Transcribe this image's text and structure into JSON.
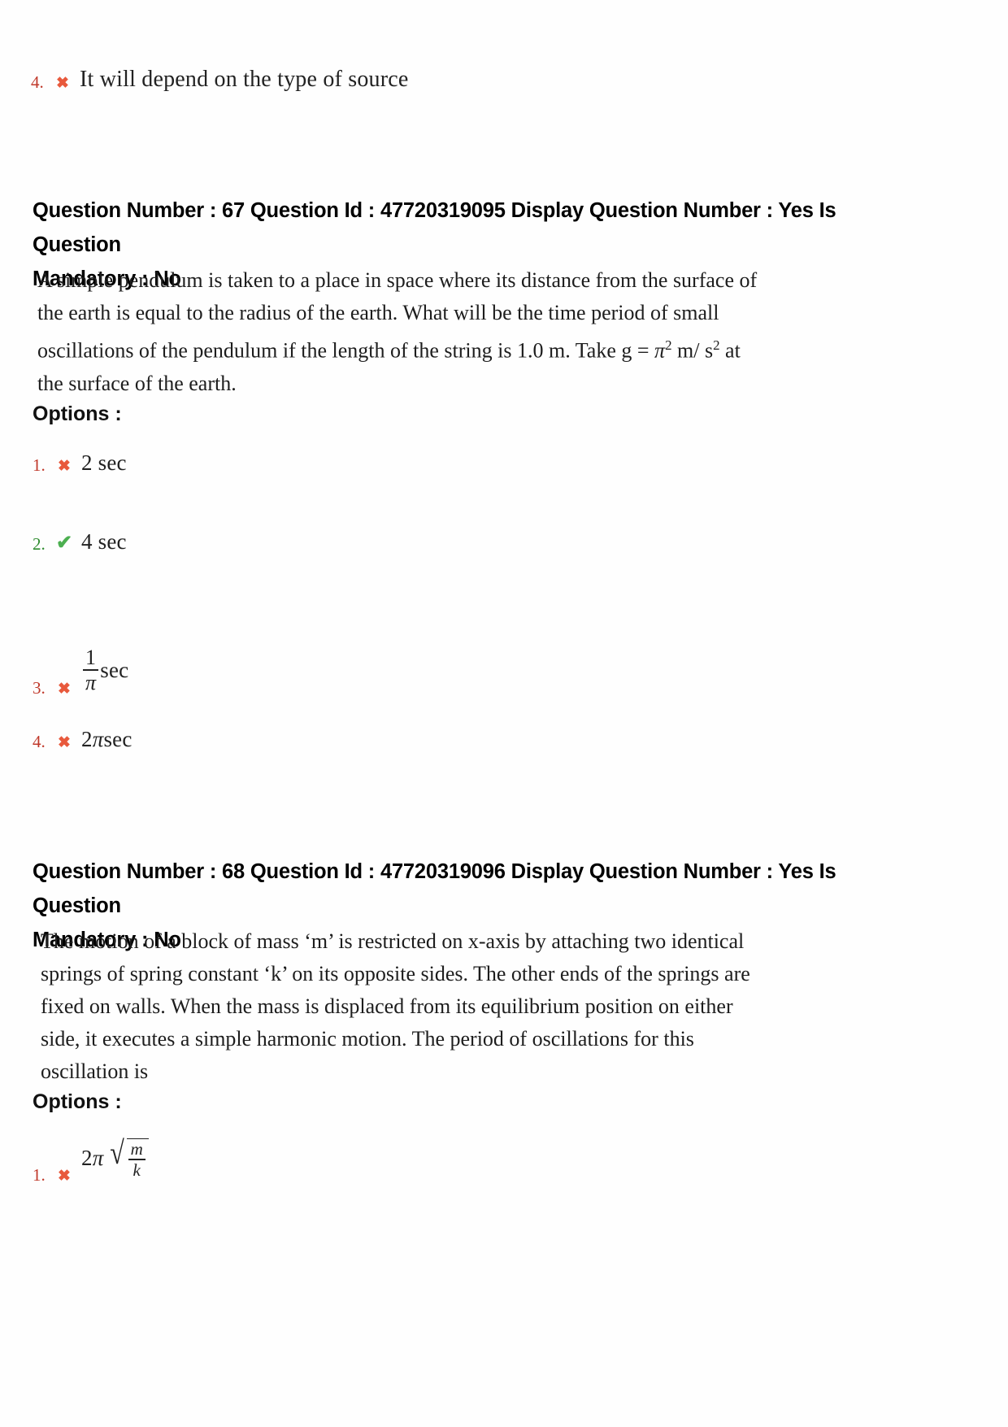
{
  "document": {
    "type": "exam-answer-key-page",
    "page_background": "#ffffff",
    "colors": {
      "wrong_mark": "#e8593c",
      "wrong_number": "#c0392b",
      "correct_mark": "#4caf50",
      "correct_number": "#2f8c2f",
      "body_text": "#1d1d1d",
      "header_text": "#000000"
    }
  },
  "previous_question_tail": {
    "option": {
      "number": "4.",
      "mark": "cross-icon",
      "text": "It will depend on the type of source"
    }
  },
  "questions": [
    {
      "header": {
        "line1": "Question Number : 67 Question Id : 47720319095 Display Question Number : Yes Is Question",
        "line2": "Mandatory : No"
      },
      "meta": {
        "question_number": "67",
        "question_id": "47720319095",
        "display_question_number": "Yes",
        "is_question_mandatory": "No"
      },
      "body_lines": [
        "A simple pendulum is taken to a place in space where its distance from the surface of",
        "the earth is equal to the radius of the earth. What will be the time period of small",
        "oscillations of the pendulum if the length of the string is 1.0 m. Take g = ",
        "the surface of the earth."
      ],
      "body_inline_math": {
        "g_value_base": "π",
        "g_value_exponent": "2",
        "g_units_prefix": " m/ s",
        "g_units_exponent": "2",
        "g_units_suffix": " at"
      },
      "options_label": "Options :",
      "options": [
        {
          "number": "1.",
          "mark": "cross-icon",
          "status": "wrong",
          "text": "2 sec"
        },
        {
          "number": "2.",
          "mark": "check-icon",
          "status": "correct",
          "text": "4 sec"
        },
        {
          "number": "3.",
          "mark": "cross-icon",
          "status": "wrong",
          "text": "",
          "math": {
            "kind": "fraction-unit",
            "numerator": "1",
            "denominator": "π",
            "unit": "sec"
          }
        },
        {
          "number": "4.",
          "mark": "cross-icon",
          "status": "wrong",
          "text": "",
          "math": {
            "kind": "coefficient-unit",
            "coefficient": "2",
            "symbol": "π",
            "unit": "sec"
          }
        }
      ]
    },
    {
      "header": {
        "line1": "Question Number : 68 Question Id : 47720319096 Display Question Number : Yes Is Question",
        "line2": "Mandatory : No"
      },
      "meta": {
        "question_number": "68",
        "question_id": "47720319096",
        "display_question_number": "Yes",
        "is_question_mandatory": "No"
      },
      "body_lines": [
        "The motion of a block of mass ‘m’ is restricted on x-axis by attaching two identical",
        "springs of spring constant ‘k’ on its opposite sides. The other ends of the springs are",
        "fixed on walls. When the mass is displaced from its equilibrium position on either",
        "side, it executes a simple harmonic motion. The period of oscillations for this",
        "oscillation is"
      ],
      "options_label": "Options :",
      "options": [
        {
          "number": "1.",
          "mark": "cross-icon",
          "status": "wrong",
          "text": "",
          "math": {
            "kind": "two-pi-sqrt-fraction",
            "coefficient": "2",
            "symbol": "π",
            "numerator": "m",
            "denominator": "k"
          }
        }
      ]
    }
  ]
}
